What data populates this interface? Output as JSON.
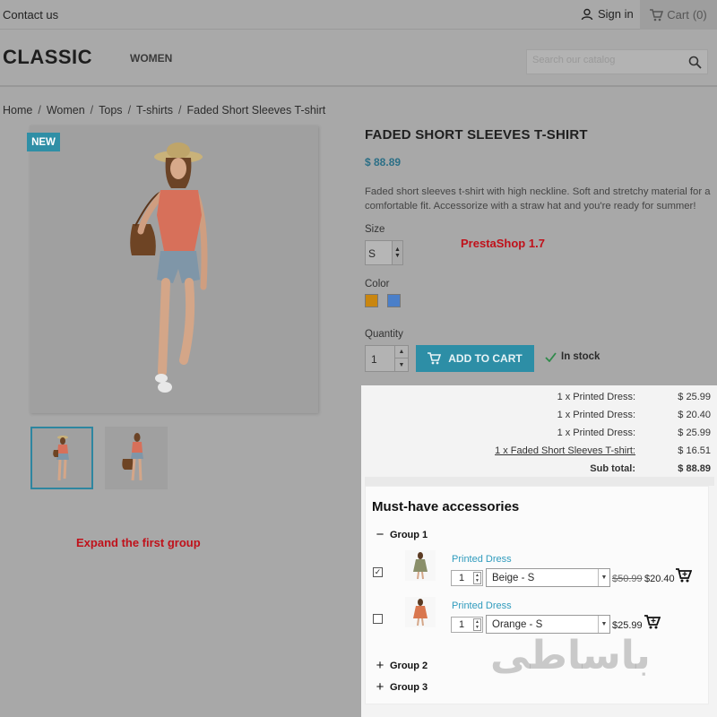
{
  "topbar": {
    "contact_label": "Contact us",
    "signin_label": "Sign in",
    "cart_label": "Cart",
    "cart_count": "(0)"
  },
  "header": {
    "logo": "CLASSIC",
    "nav": [
      "WOMEN"
    ],
    "search_placeholder": "Search our catalog"
  },
  "breadcrumb": [
    "Home",
    "Women",
    "Tops",
    "T-shirts",
    "Faded Short Sleeves T-shirt"
  ],
  "product": {
    "badge": "NEW",
    "title": "FADED SHORT SLEEVES T-SHIRT",
    "price": "$ 88.89",
    "description": "Faded short sleeves t-shirt with high neckline. Soft and stretchy material for a comfortable fit. Accessorize with a straw hat and you're ready for summer!",
    "size_label": "Size",
    "size_value": "S",
    "color_label": "Color",
    "colors": [
      "#c9860f",
      "#4a7fc9"
    ],
    "quantity_label": "Quantity",
    "quantity_value": "1",
    "add_to_cart_label": "ADD TO CART",
    "stock_label": "In stock"
  },
  "annotations": {
    "version_note": "PrestaShop 1.7",
    "expand_note": "Expand the first group"
  },
  "cart_summary": {
    "rows": [
      {
        "name": "1 x Printed Dress:",
        "amount": "$ 25.99"
      },
      {
        "name": "1 x Printed Dress:",
        "amount": "$ 20.40"
      },
      {
        "name": "1 x Printed Dress:",
        "amount": "$ 25.99"
      },
      {
        "name": "1 x Faded Short Sleeves T-shirt:",
        "amount": "$ 16.51"
      }
    ],
    "subtotal_label": "Sub total:",
    "subtotal_amount": "$ 88.89"
  },
  "accessories": {
    "title": "Must-have accessories",
    "groups": [
      {
        "label": "Group 1",
        "expanded": true
      },
      {
        "label": "Group 2",
        "expanded": false
      },
      {
        "label": "Group 3",
        "expanded": false
      }
    ],
    "items": [
      {
        "name": "Printed Dress",
        "checked": true,
        "qty": "1",
        "option": "Beige - S",
        "old_price": "$50.99",
        "price": "$20.40"
      },
      {
        "name": "Printed Dress",
        "checked": false,
        "qty": "1",
        "option": "Orange - S",
        "old_price": "",
        "price": "$25.99"
      }
    ]
  },
  "watermark": "باساطی"
}
